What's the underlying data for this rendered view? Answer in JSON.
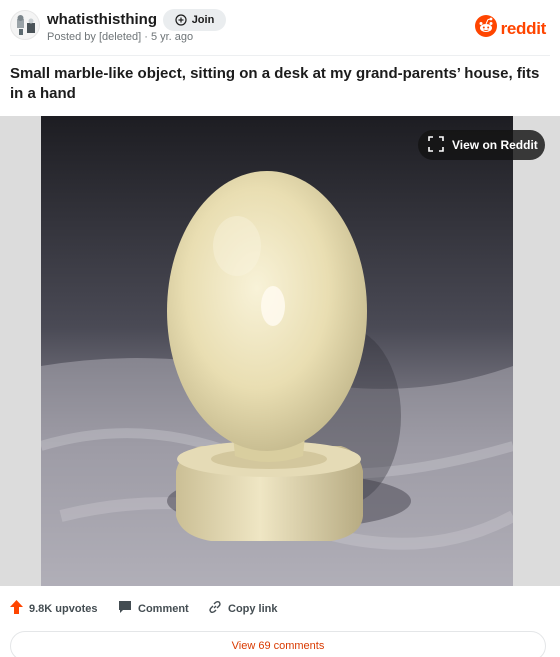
{
  "post": {
    "subreddit": "whatisthisthing",
    "join_label": "Join",
    "posted_by": "Posted by [deleted] · 5 yr. ago",
    "title": "Small marble-like object, sitting on a desk at my grand-parents’ house, fits in a hand"
  },
  "brand": {
    "wordmark": "reddit",
    "color": "#ff4500"
  },
  "media": {
    "view_label": "View on Reddit",
    "icon": "expand-icon"
  },
  "actions": {
    "upvotes": "9.8K upvotes",
    "comment": "Comment",
    "copy_link": "Copy link"
  },
  "footer": {
    "view_comments": "View 69 comments"
  },
  "colors": {
    "accent": "#ff4500",
    "link": "#d93a00",
    "muted": "#6f7578"
  }
}
